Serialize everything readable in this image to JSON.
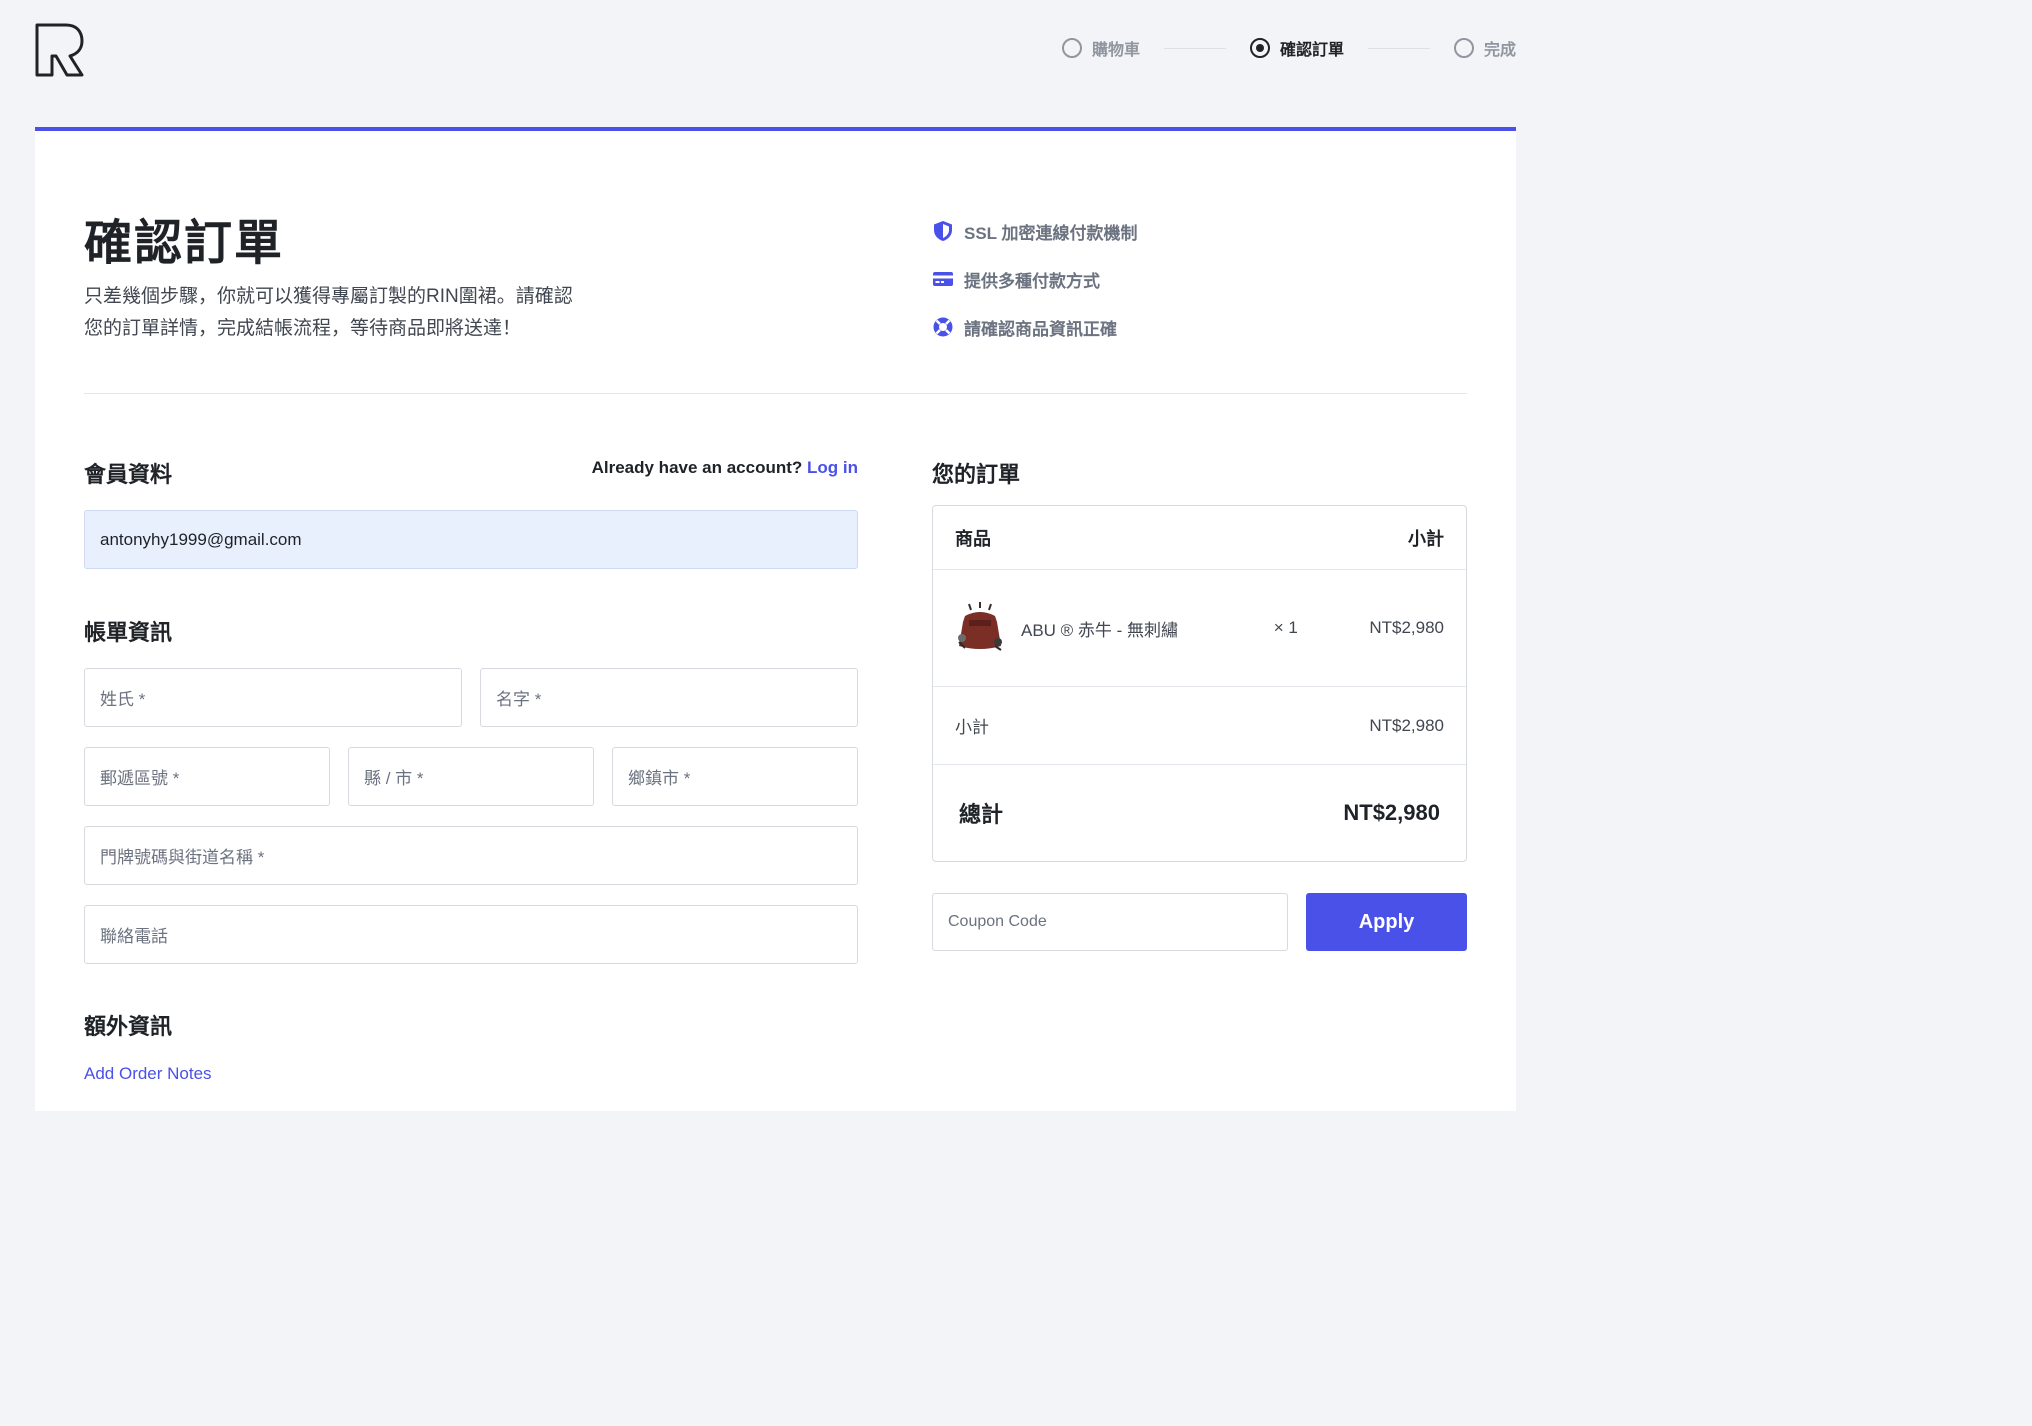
{
  "steps": [
    {
      "label": "購物車",
      "state": "inactive"
    },
    {
      "label": "確認訂單",
      "state": "active"
    },
    {
      "label": "完成",
      "state": "inactive"
    }
  ],
  "hero": {
    "title": "確認訂單",
    "description_line1": "只差幾個步驟，你就可以獲得專屬訂製的RIN圍裙。請確認",
    "description_line2": "您的訂單詳情，完成結帳流程，等待商品即將送達！"
  },
  "features": [
    {
      "icon": "shield-icon",
      "label": "SSL 加密連線付款機制"
    },
    {
      "icon": "credit-card-icon",
      "label": "提供多種付款方式"
    },
    {
      "icon": "lifebuoy-icon",
      "label": "請確認商品資訊正確"
    }
  ],
  "member": {
    "title": "會員資料",
    "account_prompt": "Already have an account?",
    "login_label": "Log in",
    "email_value": "antonyhy1999@gmail.com"
  },
  "billing": {
    "title": "帳單資訊",
    "last_name_placeholder": "姓氏 *",
    "first_name_placeholder": "名字 *",
    "postal_placeholder": "郵遞區號 *",
    "county_placeholder": "縣 / 市 *",
    "township_placeholder": "鄉鎮市 *",
    "address_placeholder": "門牌號碼與街道名稱 *",
    "phone_placeholder": "聯絡電話"
  },
  "extra": {
    "title": "額外資訊",
    "add_notes_label": "Add Order Notes"
  },
  "order": {
    "title": "您的訂單",
    "header_product": "商品",
    "header_subtotal": "小計",
    "item_name": "ABU ® 赤牛 - 無刺繡",
    "item_qty": "× 1",
    "item_price": "NT$2,980",
    "subtotal_label": "小計",
    "subtotal_value": "NT$2,980",
    "total_label": "總計",
    "total_value": "NT$2,980"
  },
  "coupon": {
    "placeholder": "Coupon Code",
    "apply_label": "Apply"
  },
  "colors": {
    "accent": "#4a51e8",
    "background": "#f3f4f7",
    "email_fill": "#e8effd"
  }
}
